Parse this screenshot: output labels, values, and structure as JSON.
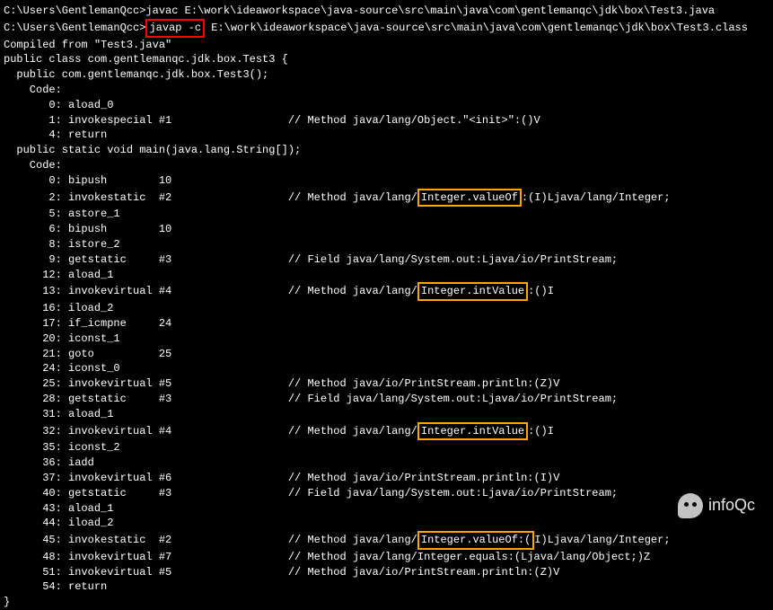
{
  "lines": [
    {
      "text": "C:\\Users\\GentlemanQcc>javac E:\\work\\ideaworkspace\\java-source\\src\\main\\java\\com\\gentlemanqc\\jdk\\box\\Test3.java"
    },
    {
      "text": ""
    },
    {
      "segments": [
        {
          "text": "C:\\Users\\GentlemanQcc>"
        },
        {
          "text": "javap -c",
          "highlight": "red"
        },
        {
          "text": " E:\\work\\ideaworkspace\\java-source\\src\\main\\java\\com\\gentlemanqc\\jdk\\box\\Test3.class"
        }
      ]
    },
    {
      "text": "Compiled from \"Test3.java\""
    },
    {
      "text": "public class com.gentlemanqc.jdk.box.Test3 {"
    },
    {
      "text": "  public com.gentlemanqc.jdk.box.Test3();"
    },
    {
      "text": "    Code:"
    },
    {
      "text": "       0: aload_0"
    },
    {
      "text": "       1: invokespecial #1                  // Method java/lang/Object.\"<init>\":()V"
    },
    {
      "text": "       4: return"
    },
    {
      "text": ""
    },
    {
      "text": "  public static void main(java.lang.String[]);"
    },
    {
      "text": "    Code:"
    },
    {
      "text": "       0: bipush        10"
    },
    {
      "segments": [
        {
          "text": "       2: invokestatic  #2                  // Method java/lang/"
        },
        {
          "text": "Integer.valueOf",
          "highlight": "orange"
        },
        {
          "text": ":(I)Ljava/lang/Integer;"
        }
      ]
    },
    {
      "text": "       5: astore_1"
    },
    {
      "text": "       6: bipush        10"
    },
    {
      "text": "       8: istore_2"
    },
    {
      "text": "       9: getstatic     #3                  // Field java/lang/System.out:Ljava/io/PrintStream;"
    },
    {
      "text": "      12: aload_1"
    },
    {
      "segments": [
        {
          "text": "      13: invokevirtual #4                  // Method java/lang/"
        },
        {
          "text": "Integer.intValue",
          "highlight": "orange"
        },
        {
          "text": ":()I"
        }
      ]
    },
    {
      "text": "      16: iload_2"
    },
    {
      "text": "      17: if_icmpne     24"
    },
    {
      "text": "      20: iconst_1"
    },
    {
      "text": "      21: goto          25"
    },
    {
      "text": "      24: iconst_0"
    },
    {
      "text": "      25: invokevirtual #5                  // Method java/io/PrintStream.println:(Z)V"
    },
    {
      "text": "      28: getstatic     #3                  // Field java/lang/System.out:Ljava/io/PrintStream;"
    },
    {
      "text": "      31: aload_1"
    },
    {
      "segments": [
        {
          "text": "      32: invokevirtual #4                  // Method java/lang/"
        },
        {
          "text": "Integer.intValue",
          "highlight": "orange"
        },
        {
          "text": ":()I"
        }
      ]
    },
    {
      "text": "      35: iconst_2"
    },
    {
      "text": "      36: iadd"
    },
    {
      "text": "      37: invokevirtual #6                  // Method java/io/PrintStream.println:(I)V"
    },
    {
      "text": "      40: getstatic     #3                  // Field java/lang/System.out:Ljava/io/PrintStream;"
    },
    {
      "text": "      43: aload_1"
    },
    {
      "text": "      44: iload_2"
    },
    {
      "segments": [
        {
          "text": "      45: invokestatic  #2                  // Method java/lang/"
        },
        {
          "text": "Integer.valueOf:(",
          "highlight": "orange"
        },
        {
          "text": "I)Ljava/lang/Integer;"
        }
      ]
    },
    {
      "text": "      48: invokevirtual #7                  // Method java/lang/Integer.equals:(Ljava/lang/Object;)Z"
    },
    {
      "text": "      51: invokevirtual #5                  // Method java/io/PrintStream.println:(Z)V"
    },
    {
      "text": "      54: return"
    },
    {
      "text": "}"
    }
  ],
  "watermark": {
    "text": "infoQc"
  }
}
